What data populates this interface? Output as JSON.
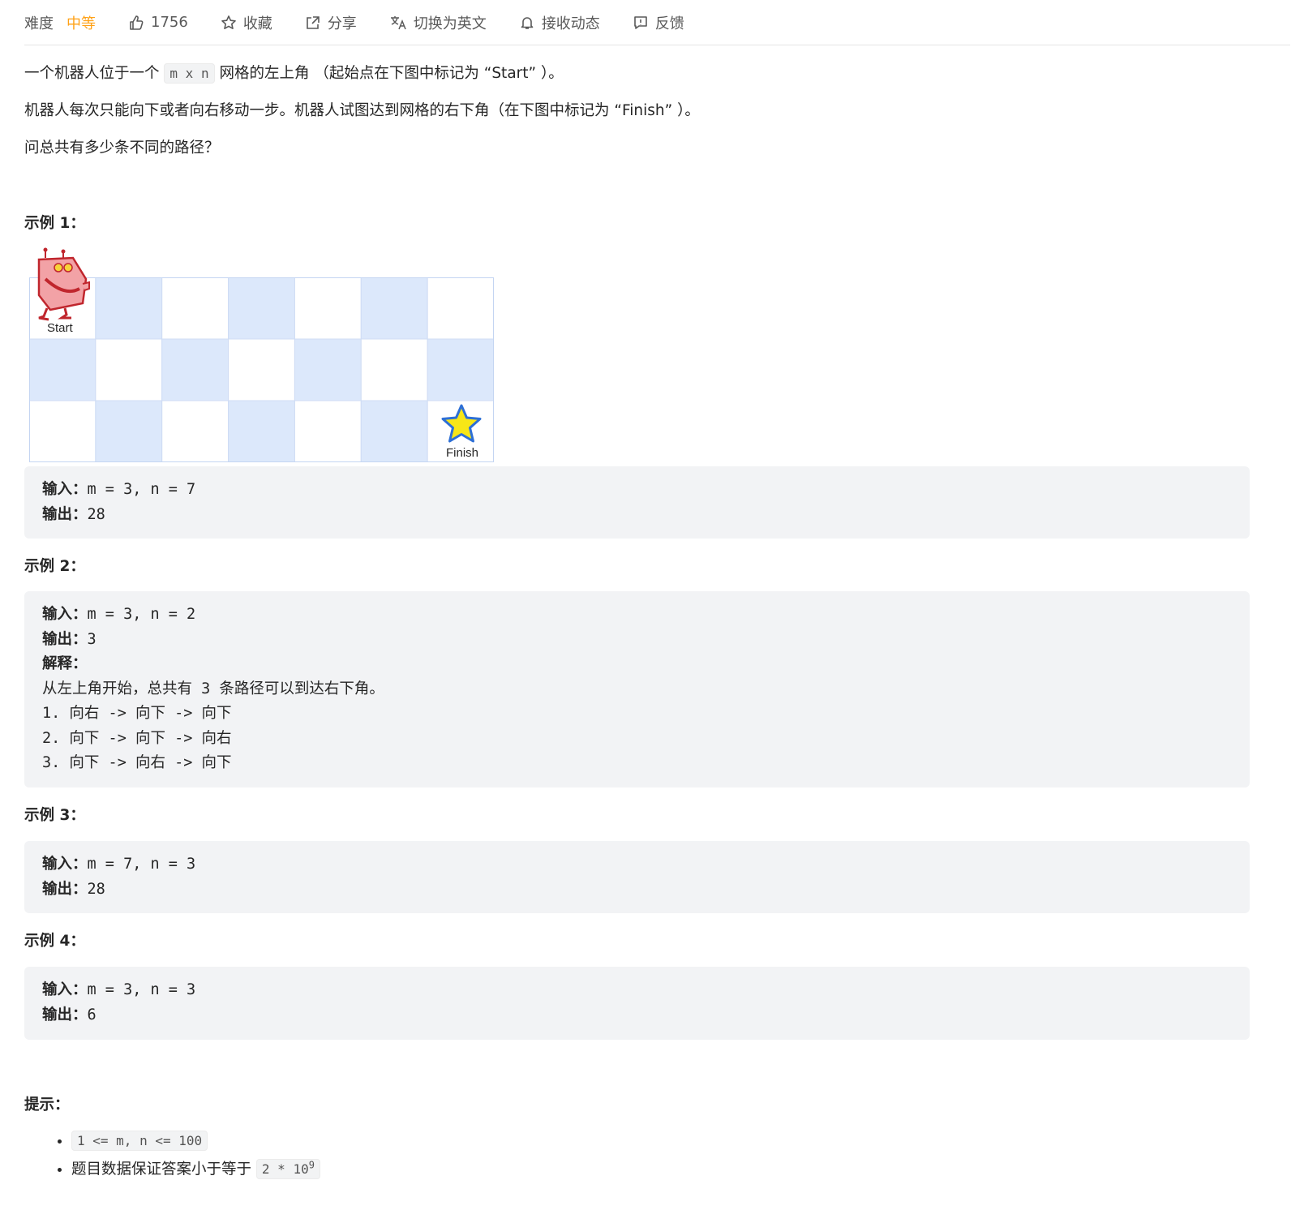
{
  "toolbar": {
    "difficulty_label": "难度",
    "difficulty_value": "中等",
    "likes": "1756",
    "favorite": "收藏",
    "share": "分享",
    "switch_lang": "切换为英文",
    "subscribe": "接收动态",
    "feedback": "反馈",
    "difficulty_color": "#ffa116"
  },
  "description": {
    "p1_before": "一个机器人位于一个",
    "p1_code": "m x n",
    "p1_after": "网格的左上角 （起始点在下图中标记为 “Start” ）。",
    "p2": "机器人每次只能向下或者向右移动一步。机器人试图达到网格的右下角（在下图中标记为 “Finish” ）。",
    "p3": "问总共有多少条不同的路径？"
  },
  "figure": {
    "start_label": "Start",
    "finish_label": "Finish",
    "rows": 3,
    "cols": 7,
    "light_color": "#dce8fb",
    "white_color": "#ffffff"
  },
  "examples": [
    {
      "title": "示例 1：",
      "lines": [
        {
          "label": "输入：",
          "text": "m = 3, n = 7"
        },
        {
          "label": "输出：",
          "text": "28"
        }
      ]
    },
    {
      "title": "示例 2：",
      "lines": [
        {
          "label": "输入：",
          "text": "m = 3, n = 2"
        },
        {
          "label": "输出：",
          "text": "3"
        },
        {
          "label": "解释：",
          "text": ""
        },
        {
          "label": "",
          "text": "从左上角开始，总共有 3 条路径可以到达右下角。"
        },
        {
          "label": "",
          "text": "1. 向右 -> 向下 -> 向下"
        },
        {
          "label": "",
          "text": "2. 向下 -> 向下 -> 向右"
        },
        {
          "label": "",
          "text": "3. 向下 -> 向右 -> 向下"
        }
      ]
    },
    {
      "title": "示例 3：",
      "lines": [
        {
          "label": "输入：",
          "text": "m = 7, n = 3"
        },
        {
          "label": "输出：",
          "text": "28"
        }
      ]
    },
    {
      "title": "示例 4：",
      "lines": [
        {
          "label": "输入：",
          "text": "m = 3, n = 3"
        },
        {
          "label": "输出：",
          "text": "6"
        }
      ]
    }
  ],
  "hints": {
    "title": "提示：",
    "item1_code": "1 <= m, n <= 100",
    "item2_text": "题目数据保证答案小于等于",
    "item2_code": "2 * 10",
    "item2_sup": "9"
  }
}
